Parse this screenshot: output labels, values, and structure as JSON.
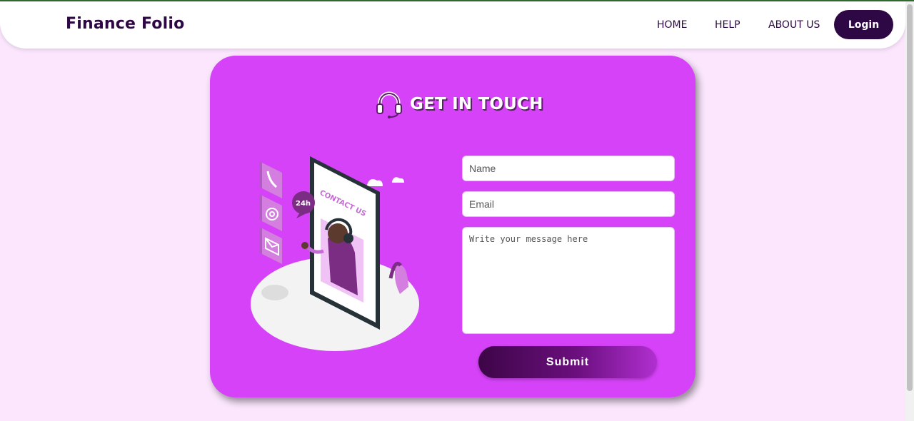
{
  "navbar": {
    "brand": "Finance Folio",
    "links": [
      "HOME",
      "HELP",
      "ABOUT US"
    ],
    "login_label": "Login"
  },
  "contact": {
    "title": "GET IN TOUCH",
    "name_placeholder": "Name",
    "email_placeholder": "Email",
    "message_placeholder": "Write your message here",
    "submit_label": "Submit",
    "illustration": {
      "heading": "CONTACT US",
      "badge": "24h",
      "icons": [
        "phone-icon",
        "at-icon",
        "mail-icon"
      ]
    }
  },
  "colors": {
    "background": "#fbe6fd",
    "card": "#d542f7",
    "brand_dark": "#2e0844"
  }
}
